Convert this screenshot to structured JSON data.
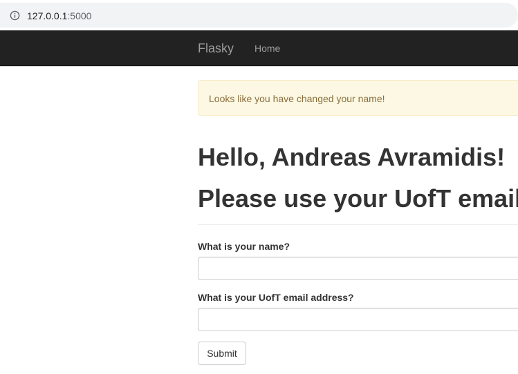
{
  "browser": {
    "url_host": "127.0.0.1",
    "url_port": ":5000",
    "info_icon": "info-circle-icon"
  },
  "navbar": {
    "brand": "Flasky",
    "home_label": "Home",
    "background_color": "#222222",
    "link_color": "#9d9d9d"
  },
  "alert": {
    "message": "Looks like you have changed your name!",
    "background_color": "#fcf8e3",
    "text_color": "#8a6d3b"
  },
  "main": {
    "greeting": "Hello, Andreas Avramidis!",
    "notice": "Please use your UofT email."
  },
  "form": {
    "name_label": "What is your name?",
    "name_value": "",
    "email_label": "What is your UofT email address?",
    "email_value": "",
    "submit_label": "Submit"
  }
}
